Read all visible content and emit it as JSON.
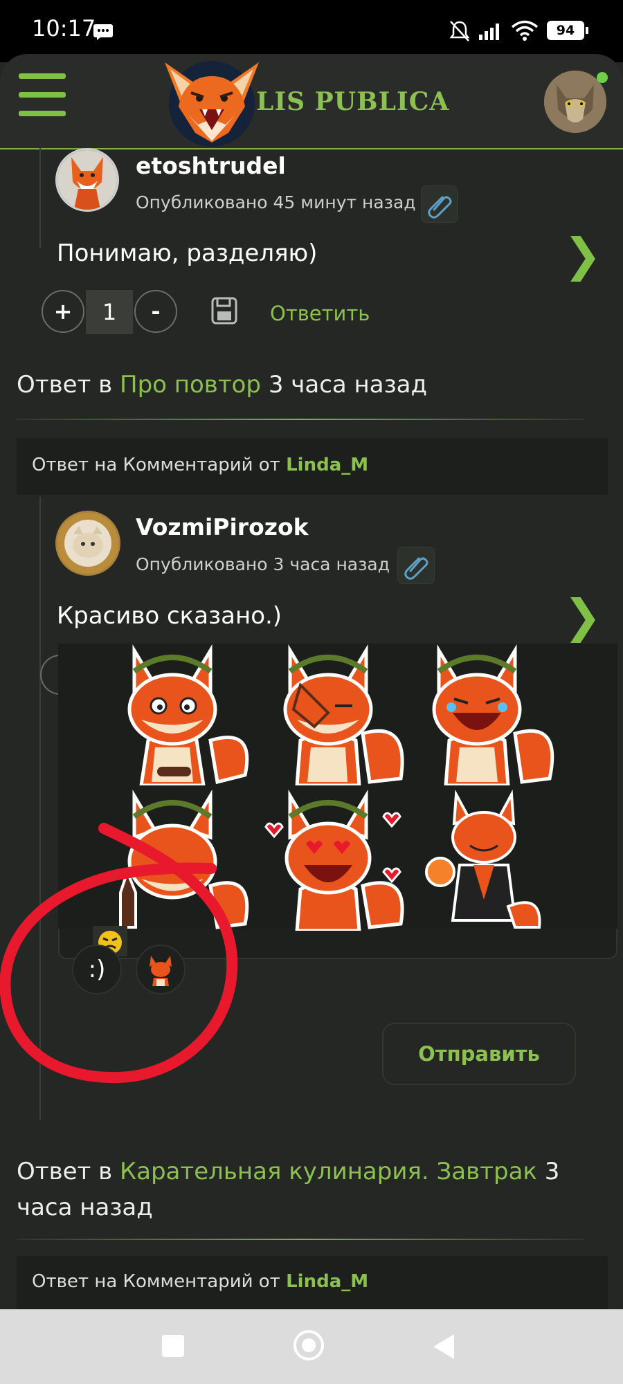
{
  "status_bar": {
    "time": "10:17",
    "battery": "94"
  },
  "header": {
    "site_title": "LIS PUBLICA"
  },
  "comments": [
    {
      "author": "etoshtrudel",
      "published": "Опубликовано 45 минут назад",
      "text": "Понимаю, разделяю)",
      "score": "1",
      "plus": "+",
      "minus": "-",
      "reply_label": "Ответить"
    },
    {
      "reply_prefix": "Ответ в",
      "topic": "Про повтор",
      "time": "3 часа назад",
      "reply_to_prefix": "Ответ на Комментарий от",
      "reply_to_user": "Linda_M",
      "author": "VozmiPirozok",
      "published": "Опубликовано 3 часа назад",
      "text": "Красиво сказано.)"
    },
    {
      "reply_prefix": "Ответ в",
      "topic": "Карательная кулинария. Завтрак",
      "time": "3 часа",
      "time2": "назад",
      "reply_to_prefix": "Ответ на Комментарий от",
      "reply_to_user": "Linda_M"
    }
  ],
  "composer": {
    "smiley_tab": ":)",
    "send_label": "Отправить"
  },
  "arrow_glyph": "❯",
  "colors": {
    "accent": "#8cc152",
    "background": "#252724",
    "fox_orange": "#e8541c",
    "annotation_red": "#e8192c"
  },
  "icons": [
    "notification-icon",
    "mute-icon",
    "signal-icon",
    "wifi-icon",
    "battery-icon",
    "menu-icon",
    "fox-logo-icon",
    "attachment-icon",
    "save-icon",
    "chevron-right-icon",
    "square-nav-icon",
    "circle-nav-icon",
    "back-nav-icon"
  ]
}
